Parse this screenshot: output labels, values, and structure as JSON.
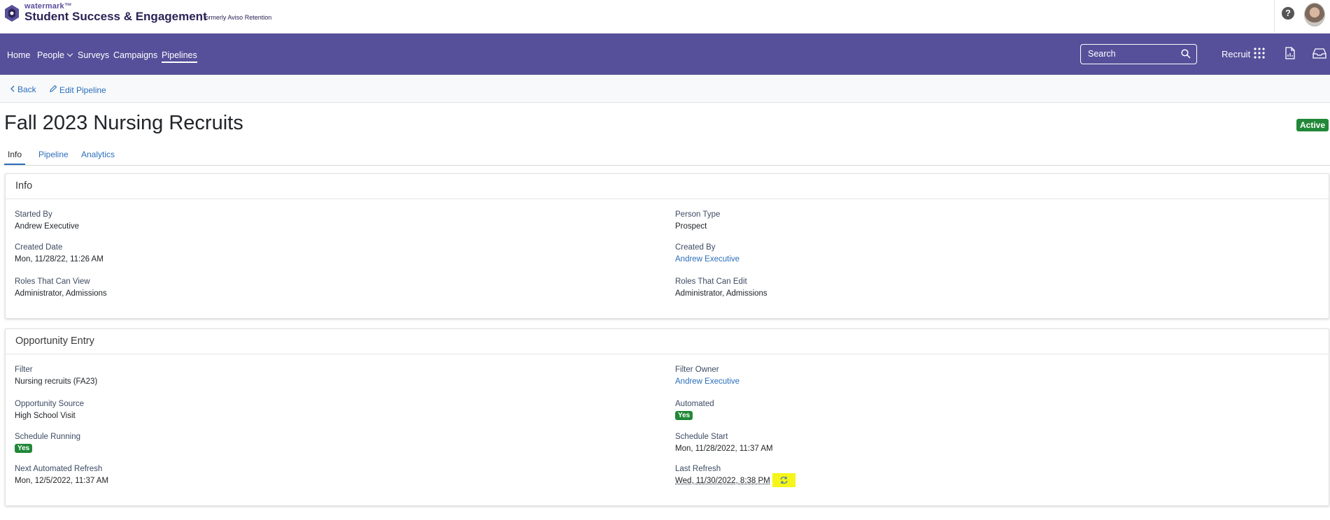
{
  "brand": {
    "small": "watermark™",
    "name": "Student Success & Engagement",
    "formerly": "| formerly Aviso Retention"
  },
  "nav": {
    "items": [
      "Home",
      "People",
      "Surveys",
      "Campaigns",
      "Pipelines"
    ],
    "active": "Pipelines",
    "search_placeholder": "Search",
    "recruit_label": "Recruit"
  },
  "toolbar": {
    "back_label": "Back",
    "edit_label": "Edit Pipeline"
  },
  "page": {
    "title": "Fall 2023 Nursing Recruits",
    "status": "Active",
    "tabs": [
      "Info",
      "Pipeline",
      "Analytics"
    ],
    "active_tab": "Info"
  },
  "info": {
    "header": "Info",
    "started_by_label": "Started By",
    "started_by": "Andrew Executive",
    "person_type_label": "Person Type",
    "person_type": "Prospect",
    "created_date_label": "Created Date",
    "created_date": "Mon, 11/28/22, 11:26 AM",
    "created_by_label": "Created By",
    "created_by": "Andrew Executive",
    "roles_view_label": "Roles That Can View",
    "roles_view": "Administrator, Admissions",
    "roles_edit_label": "Roles That Can Edit",
    "roles_edit": "Administrator, Admissions"
  },
  "opportunity": {
    "header": "Opportunity Entry",
    "filter_label": "Filter",
    "filter": "Nursing recruits (FA23)",
    "filter_owner_label": "Filter Owner",
    "filter_owner": "Andrew Executive",
    "source_label": "Opportunity Source",
    "source": "High School Visit",
    "automated_label": "Automated",
    "automated": "Yes",
    "schedule_running_label": "Schedule Running",
    "schedule_running": "Yes",
    "schedule_start_label": "Schedule Start",
    "schedule_start": "Mon, 11/28/2022, 11:37 AM",
    "next_refresh_label": "Next Automated Refresh",
    "next_refresh": "Mon, 12/5/2022, 11:37 AM",
    "last_refresh_label": "Last Refresh",
    "last_refresh": "Wed, 11/30/2022, 8:38 PM"
  },
  "colors": {
    "nav_purple": "#56509a",
    "link_blue": "#2a6ebb",
    "badge_green": "#218838",
    "highlight_yellow": "#f5f519"
  }
}
